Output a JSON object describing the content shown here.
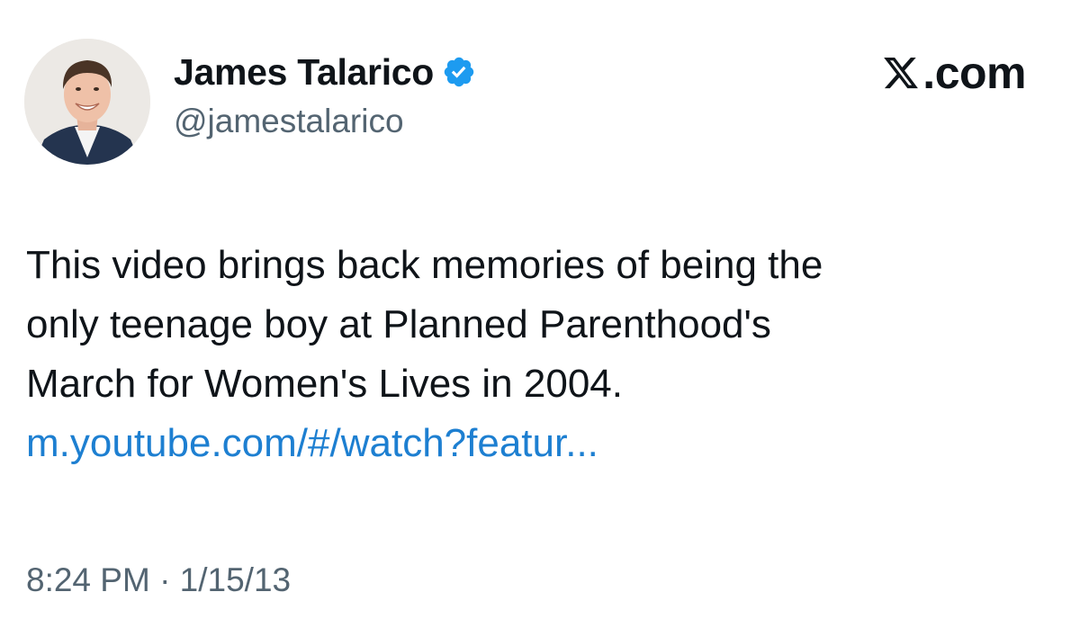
{
  "author": {
    "display_name": "James Talarico",
    "handle": "@jamestalarico",
    "verified": true
  },
  "brand": {
    "label": ".com",
    "logo_icon": "x-logo-icon"
  },
  "tweet": {
    "text_lines": [
      "This video brings back memories of being the",
      "only teenage boy at Planned Parenthood's",
      "March for Women's Lives in 2004."
    ],
    "link_text": "m.youtube.com/#/watch?featur..."
  },
  "meta": {
    "timestamp": "8:24 PM · 1/15/13"
  },
  "colors": {
    "text": "#0f1419",
    "secondary": "#536471",
    "link": "#1d7fd1",
    "verified_badge": "#1d9bf0"
  }
}
